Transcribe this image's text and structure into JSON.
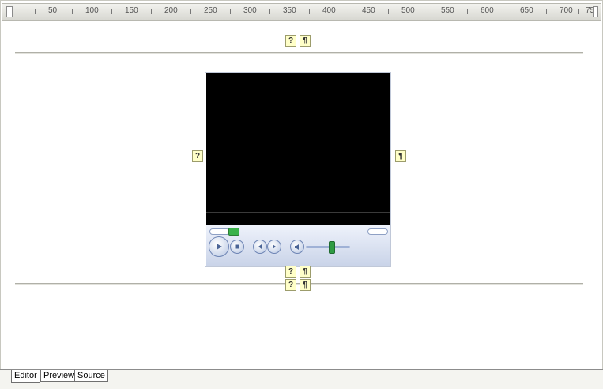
{
  "ruler": {
    "labels": [
      "50",
      "100",
      "150",
      "200",
      "250",
      "300",
      "350",
      "400",
      "450",
      "500",
      "550",
      "600",
      "650",
      "700",
      "75"
    ]
  },
  "markers": {
    "question": "?",
    "pilcrow": "¶"
  },
  "tabs": [
    {
      "label": "Editor",
      "active": true
    },
    {
      "label": "Preview",
      "active": false
    },
    {
      "label": "Source",
      "active": false
    }
  ]
}
